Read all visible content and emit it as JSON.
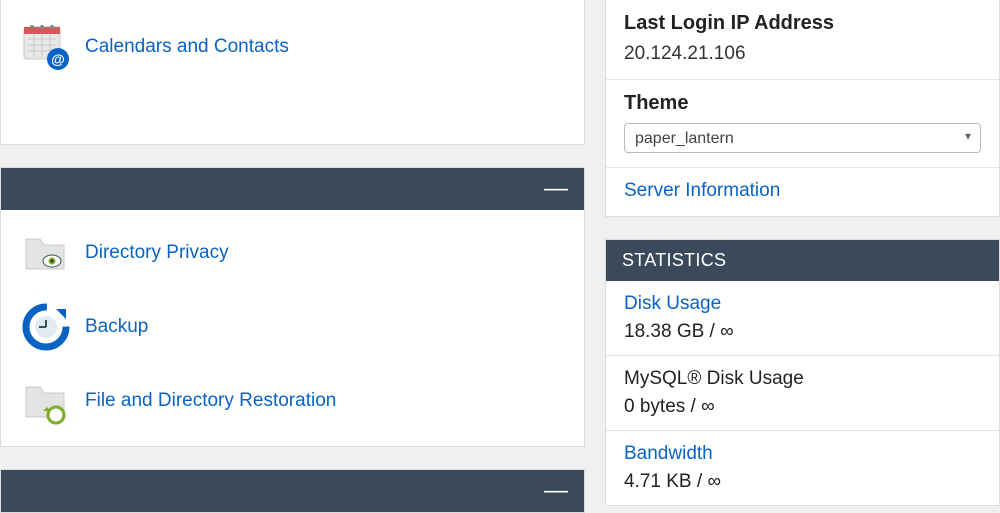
{
  "left": {
    "calendars_label": "Calendars and Contacts",
    "directory_privacy_label": "Directory Privacy",
    "backup_label": "Backup",
    "file_restore_label": "File and Directory Restoration"
  },
  "right": {
    "last_login_title": "Last Login IP Address",
    "last_login_value": "20.124.21.106",
    "theme_title": "Theme",
    "theme_value": "paper_lantern",
    "server_info_link": "Server Information",
    "stats_header": "STATISTICS",
    "stats": {
      "disk_usage_label": "Disk Usage",
      "disk_usage_value": "18.38 GB / ∞",
      "mysql_label": "MySQL® Disk Usage",
      "mysql_value": "0 bytes / ∞",
      "bandwidth_label": "Bandwidth",
      "bandwidth_value": "4.71 KB / ∞"
    }
  },
  "ui": {
    "collapse_icon": "—"
  }
}
